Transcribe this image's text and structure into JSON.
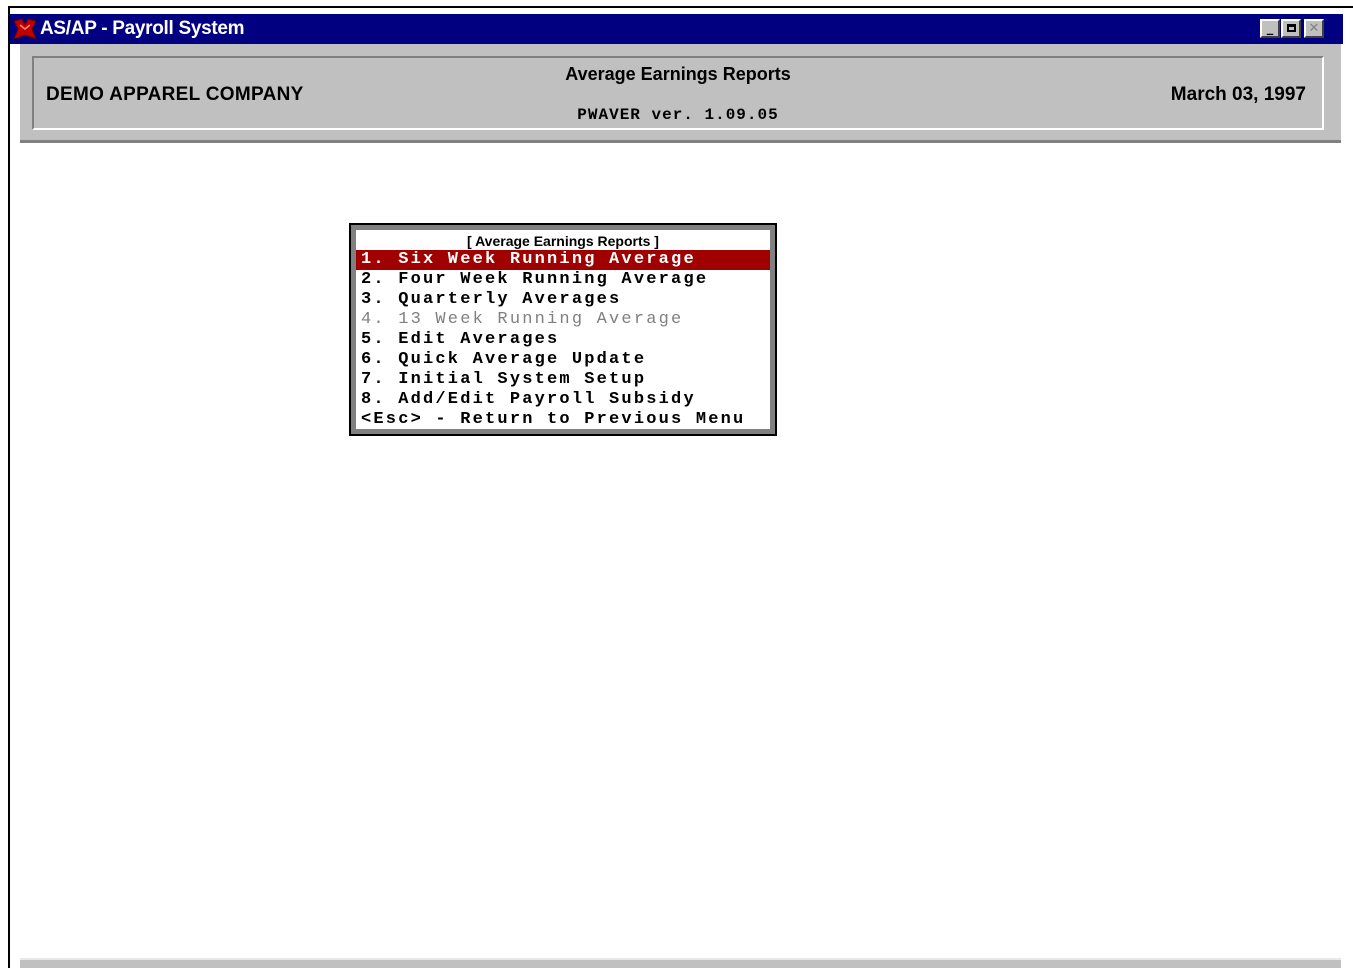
{
  "window": {
    "title": "AS/AP - Payroll System",
    "controls": {
      "minimize": "_",
      "restore": "🗗",
      "close": "✕"
    }
  },
  "header": {
    "company": "DEMO APPAREL COMPANY",
    "report_title": "Average Earnings Reports",
    "version": "PWAVER ver. 1.09.05",
    "date": "March 03, 1997"
  },
  "menu": {
    "title": "[ Average Earnings Reports ]",
    "items": [
      {
        "label": "1. Six Week Running Average",
        "state": "selected"
      },
      {
        "label": "2. Four Week Running Average",
        "state": "normal"
      },
      {
        "label": "3. Quarterly Averages",
        "state": "normal"
      },
      {
        "label": "4. 13 Week Running Average",
        "state": "disabled"
      },
      {
        "label": "5. Edit Averages",
        "state": "normal"
      },
      {
        "label": "6. Quick Average Update",
        "state": "normal"
      },
      {
        "label": "7. Initial System Setup",
        "state": "normal"
      },
      {
        "label": "8. Add/Edit Payroll Subsidy",
        "state": "normal"
      },
      {
        "label": "<Esc> - Return to Previous Menu",
        "state": "normal"
      }
    ]
  },
  "colors": {
    "titlebar": "#000080",
    "selected_item": "#a00000",
    "panel": "#c0c0c0"
  }
}
